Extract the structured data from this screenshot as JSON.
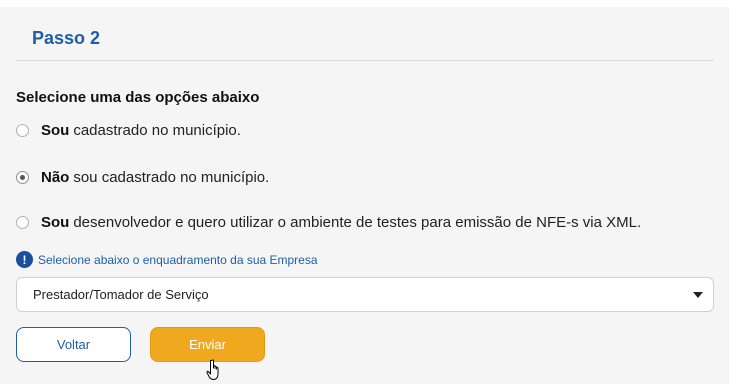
{
  "step": {
    "title": "Passo 2"
  },
  "form": {
    "question": "Selecione uma das opções abaixo",
    "options": [
      {
        "bold": "Sou",
        "text": "cadastrado no município.",
        "checked": false
      },
      {
        "bold": "Não",
        "text": "sou cadastrado no município.",
        "checked": true
      },
      {
        "bold": "Sou",
        "text": "desenvolvedor e quero utilizar o ambiente de testes para emissão de NFE-s via XML.",
        "checked": false
      }
    ],
    "hint": "Selecione abaixo o enquadramento da sua Empresa",
    "hint_icon": "!",
    "select": {
      "value": "Prestador/Tomador de Serviço"
    }
  },
  "buttons": {
    "back": "Voltar",
    "send": "Enviar"
  },
  "colors": {
    "accent": "#1f5fa6",
    "primary_button": "#f0a81e"
  }
}
